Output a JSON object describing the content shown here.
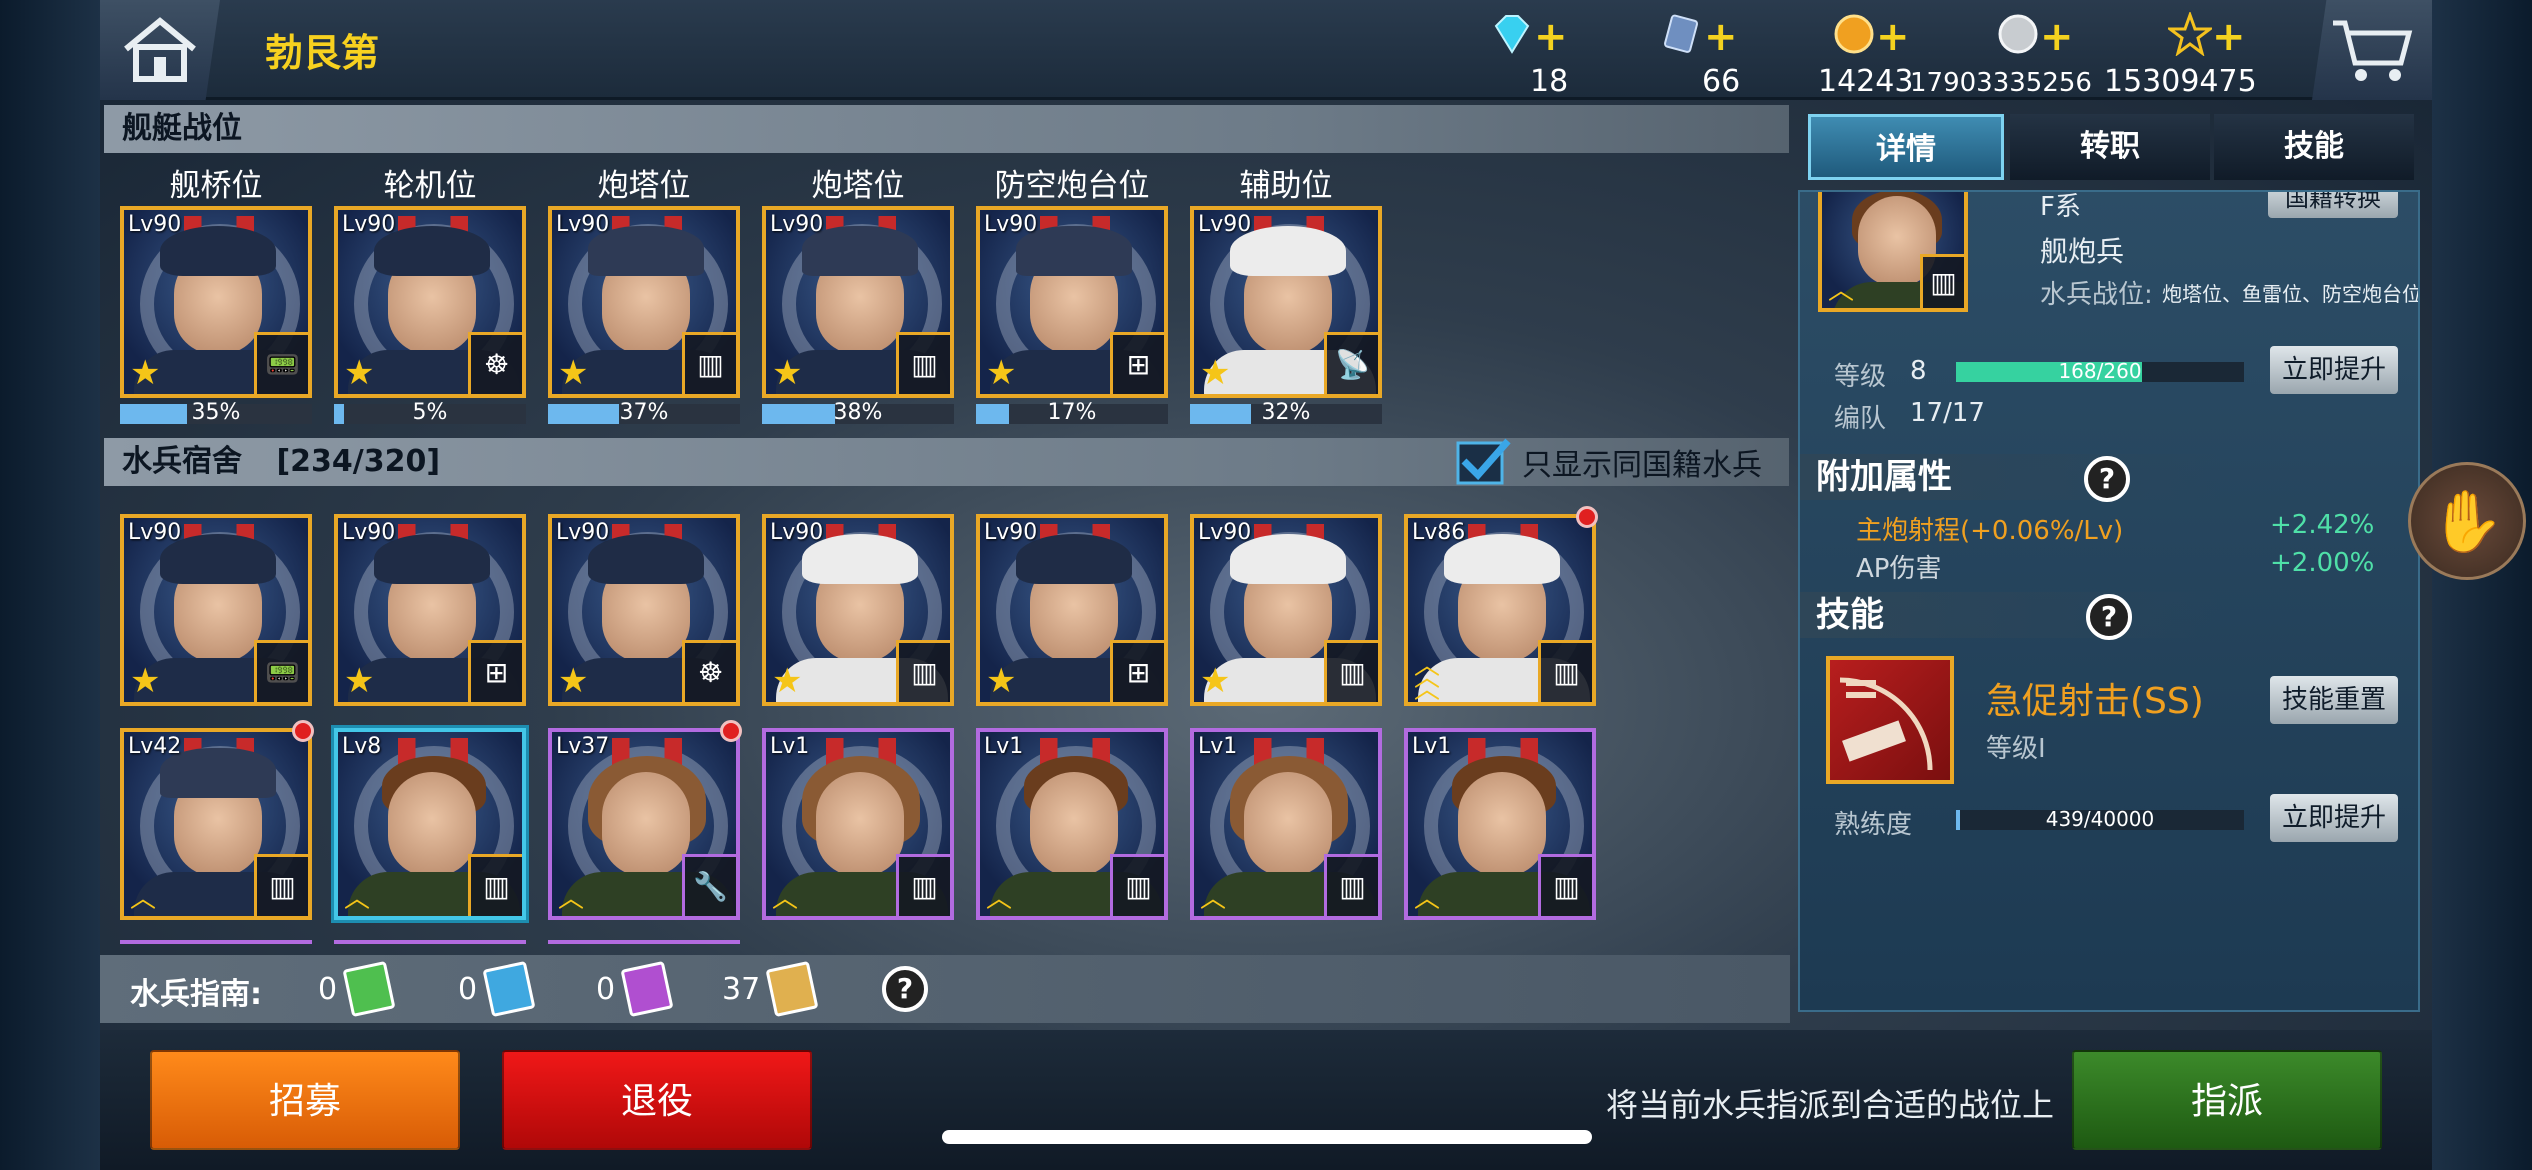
{
  "header": {
    "title": "勃艮第",
    "resources": [
      {
        "name": "diamond",
        "value": "18",
        "color": "#38d0f0"
      },
      {
        "name": "ticket",
        "value": "66",
        "color": "#6f8fc0"
      },
      {
        "name": "gold",
        "value": "14243",
        "color": "#f0a020"
      },
      {
        "name": "silver",
        "value": "17903335256",
        "color": "#c8ccd0"
      },
      {
        "name": "star",
        "value": "15309475",
        "color": "#f4c21f"
      }
    ]
  },
  "battle_section": {
    "title": "舰艇战位",
    "slots": [
      {
        "label": "舰桥位",
        "level": "Lv90",
        "progress": "35%",
        "role_icon": "radio-icon",
        "variant": "navy",
        "rank": "star"
      },
      {
        "label": "轮机位",
        "level": "Lv90",
        "progress": "5%",
        "role_icon": "helm-icon",
        "variant": "navy-gold",
        "rank": "star"
      },
      {
        "label": "炮塔位",
        "level": "Lv90",
        "progress": "37%",
        "role_icon": "turret-icon",
        "variant": "cap",
        "rank": "star"
      },
      {
        "label": "炮塔位",
        "level": "Lv90",
        "progress": "38%",
        "role_icon": "turret-icon",
        "variant": "cap",
        "rank": "star"
      },
      {
        "label": "防空炮台位",
        "level": "Lv90",
        "progress": "17%",
        "role_icon": "aa-gun-icon",
        "variant": "cap",
        "rank": "star"
      },
      {
        "label": "辅助位",
        "level": "Lv90",
        "progress": "32%",
        "role_icon": "radar-icon",
        "variant": "white",
        "rank": "star"
      }
    ]
  },
  "dorm_section": {
    "title": "水兵宿舍",
    "count": "[234/320]",
    "filter_label": "只显示同国籍水兵",
    "filter_checked": true,
    "row1": [
      {
        "level": "Lv90",
        "role_icon": "radio-icon",
        "variant": "navy",
        "rank": "star"
      },
      {
        "level": "Lv90",
        "role_icon": "aa-gun-icon",
        "variant": "navy",
        "rank": "star"
      },
      {
        "level": "Lv90",
        "role_icon": "helm-icon",
        "variant": "navy",
        "rank": "star"
      },
      {
        "level": "Lv90",
        "role_icon": "turret-icon",
        "variant": "white",
        "rank": "star"
      },
      {
        "level": "Lv90",
        "role_icon": "aa-gun-icon",
        "variant": "navy",
        "rank": "star"
      },
      {
        "level": "Lv90",
        "role_icon": "turret-icon",
        "variant": "white",
        "rank": "star"
      },
      {
        "level": "Lv86",
        "role_icon": "turret-icon",
        "variant": "white",
        "rank": "chevrons",
        "alert": true
      }
    ],
    "row2": [
      {
        "level": "Lv42",
        "role_icon": "turret-icon",
        "variant": "cap",
        "rank": "chevron",
        "alert": true,
        "frame": "gold"
      },
      {
        "level": "Lv8",
        "role_icon": "turret-icon",
        "variant": "male",
        "rank": "chevron",
        "frame": "selected"
      },
      {
        "level": "Lv37",
        "role_icon": "wrench-icon",
        "variant": "female",
        "rank": "chevron",
        "alert": true,
        "frame": "purple"
      },
      {
        "level": "Lv1",
        "role_icon": "turret-icon",
        "variant": "female",
        "rank": "chevron",
        "frame": "purple"
      },
      {
        "level": "Lv1",
        "role_icon": "turret-icon",
        "variant": "male",
        "rank": "chevron",
        "frame": "purple"
      },
      {
        "level": "Lv1",
        "role_icon": "turret-icon",
        "variant": "female",
        "rank": "chevron",
        "frame": "purple"
      },
      {
        "level": "Lv1",
        "role_icon": "turret-icon",
        "variant": "male",
        "rank": "chevron",
        "frame": "purple"
      }
    ]
  },
  "guide": {
    "label": "水兵指南:",
    "books": [
      {
        "count": "0",
        "color": "#4fbf4f"
      },
      {
        "count": "0",
        "color": "#3fa8e0"
      },
      {
        "count": "0",
        "color": "#b04fd0"
      },
      {
        "count": "37",
        "color": "#e0b04f"
      }
    ]
  },
  "tabs": [
    "详情",
    "转职",
    "技能"
  ],
  "details": {
    "nation_line": "F系",
    "nation_button": "国籍转换",
    "job": "舰炮兵",
    "station_label": "水兵战位:",
    "station_value": "炮塔位、鱼雷位、防空炮台位",
    "level_label": "等级",
    "level_value": "8",
    "exp_text": "168/260",
    "exp_fraction": 0.646,
    "upgrade_button": "立即提升",
    "team_label": "编队",
    "team_value": "17/17",
    "extra_title": "附加属性",
    "attrs": [
      {
        "name": "主炮射程(+0.06%/Lv)",
        "value": "+2.42%",
        "color": "#f0a020"
      },
      {
        "name": "AP伤害",
        "value": "+2.00%",
        "color": "#cfd7de"
      }
    ],
    "skill_title": "技能",
    "skill_name": "急促射击(SS)",
    "skill_level": "等级I",
    "skill_reset_button": "技能重置",
    "proficiency_label": "熟练度",
    "proficiency_text": "439/40000",
    "proficiency_fraction": 0.011,
    "proficiency_button": "立即提升"
  },
  "bottom": {
    "recruit": "招募",
    "retire": "退役",
    "hint": "将当前水兵指派到合适的战位上",
    "assign": "指派"
  }
}
